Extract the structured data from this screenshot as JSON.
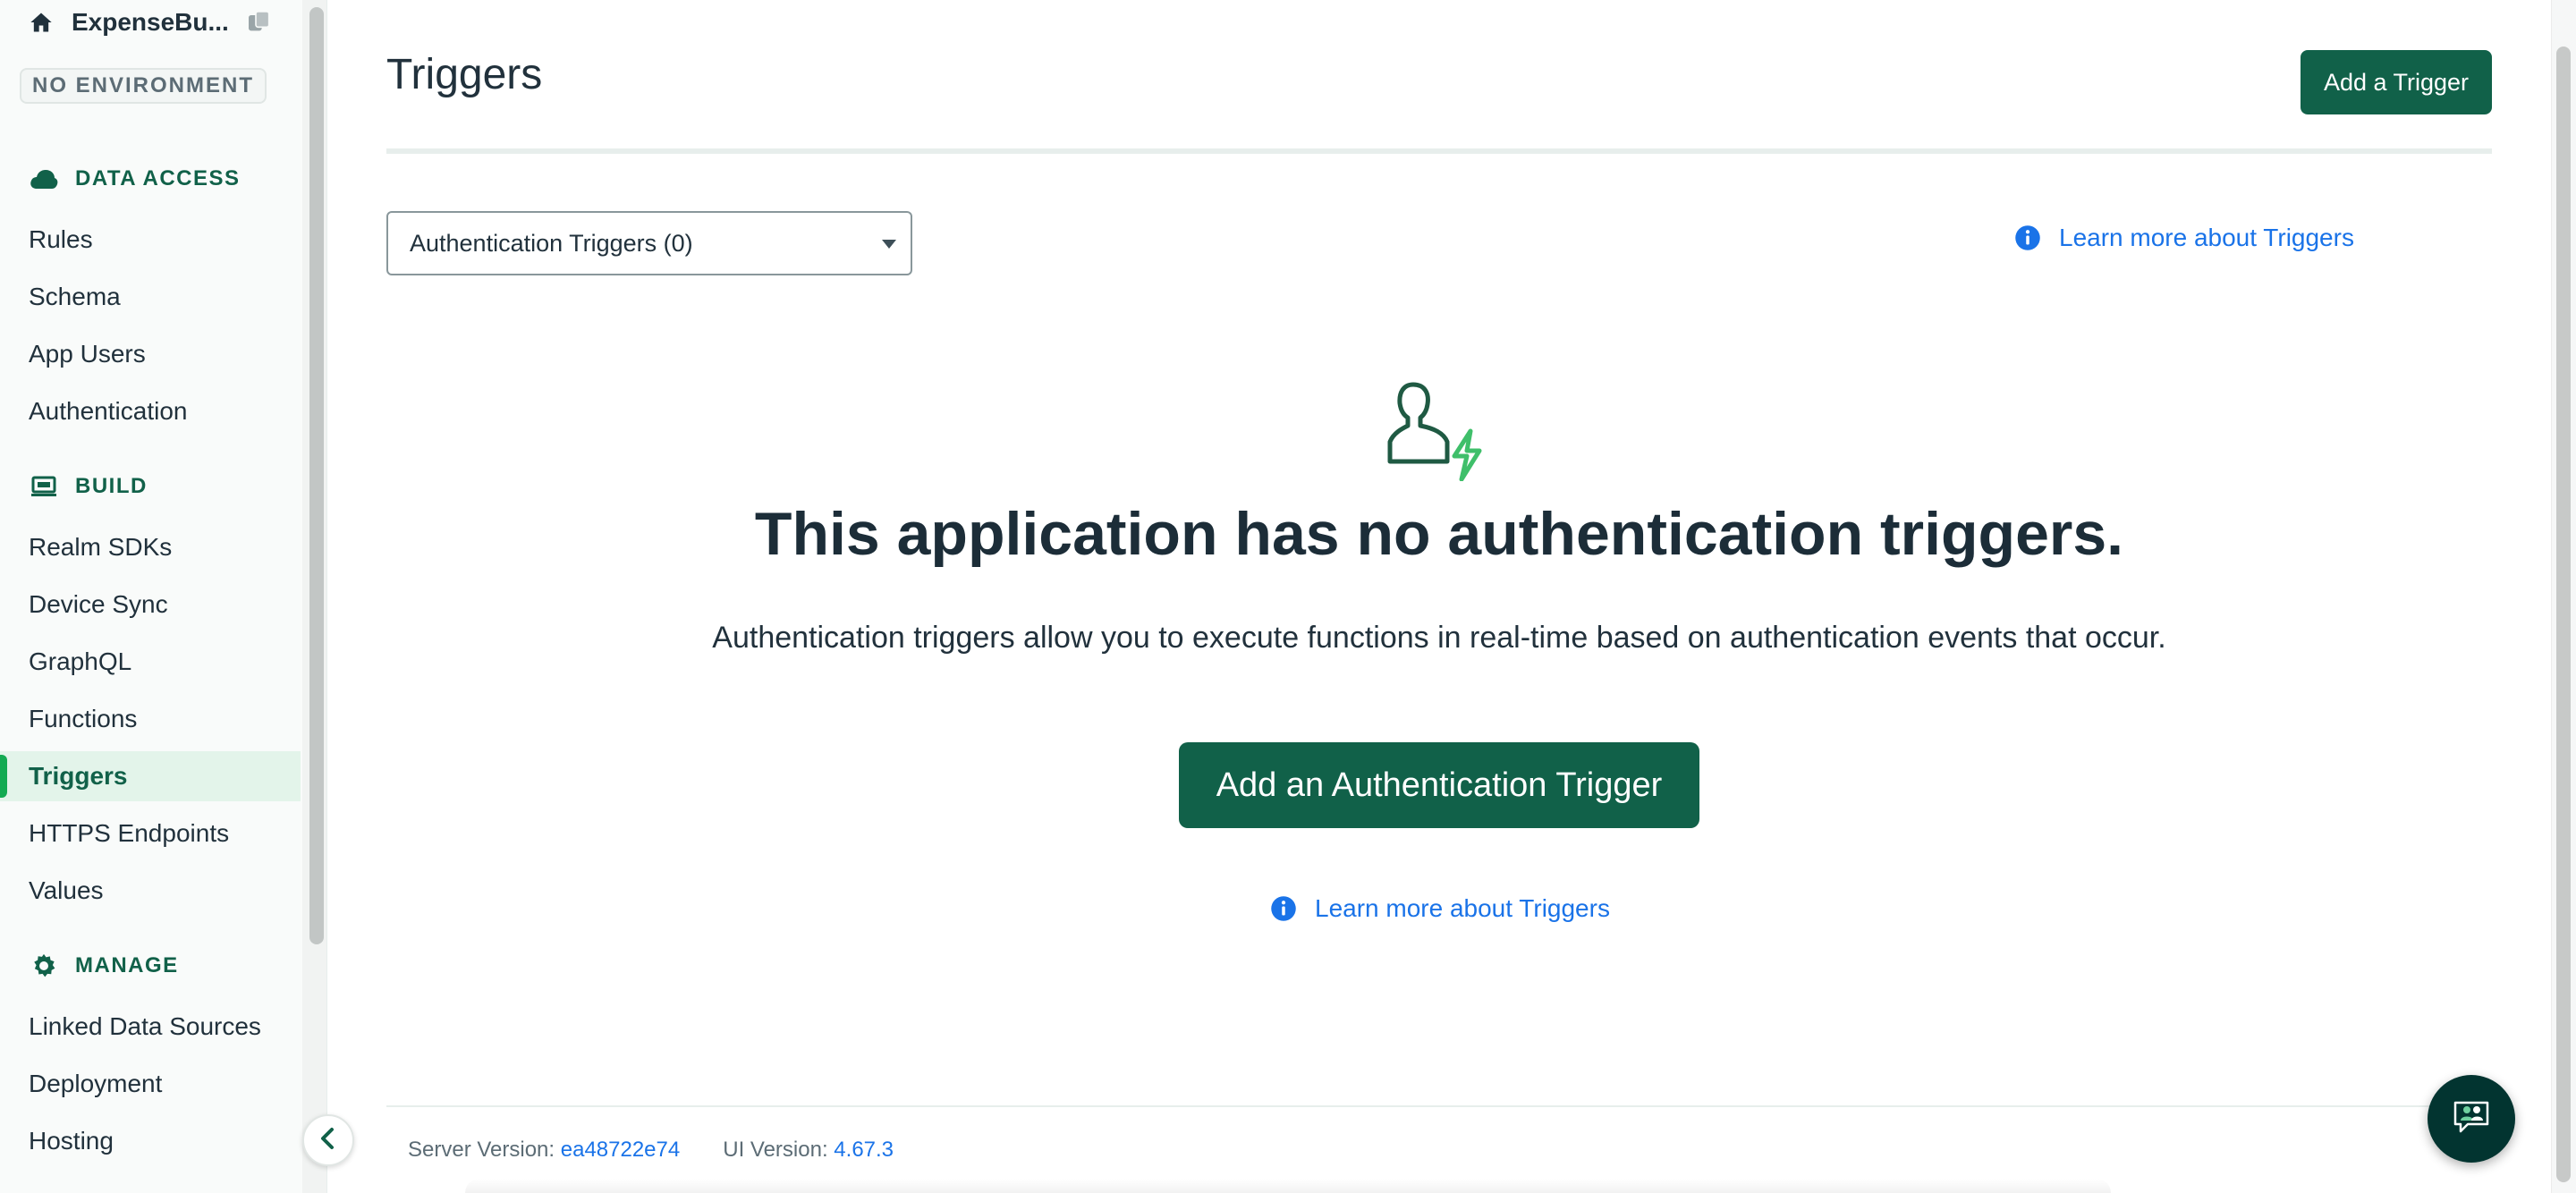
{
  "sidebar": {
    "app_name": "ExpenseBu...",
    "environment_badge": "NO ENVIRONMENT",
    "sections": {
      "data_access": {
        "title": "DATA ACCESS",
        "items": [
          "Rules",
          "Schema",
          "App Users",
          "Authentication"
        ]
      },
      "build": {
        "title": "BUILD",
        "items": [
          "Realm SDKs",
          "Device Sync",
          "GraphQL",
          "Functions",
          "Triggers",
          "HTTPS Endpoints",
          "Values"
        ]
      },
      "manage": {
        "title": "MANAGE",
        "items": [
          "Linked Data Sources",
          "Deployment",
          "Hosting"
        ]
      }
    },
    "active_item": "Triggers"
  },
  "header": {
    "title": "Triggers",
    "add_button": "Add a Trigger"
  },
  "filter": {
    "selected": "Authentication Triggers (0)"
  },
  "learn_more": "Learn more about Triggers",
  "empty_state": {
    "icon": "user-bolt-icon",
    "title": "This application has no authentication triggers.",
    "description": "Authentication triggers allow you to execute functions in real-time based on authentication events that occur.",
    "button": "Add an Authentication Trigger"
  },
  "footer": {
    "server_label": "Server Version:",
    "server_version": "ea48722e74",
    "ui_label": "UI Version:",
    "ui_version": "4.67.3"
  },
  "colors": {
    "primary": "#116149",
    "accent_green": "#13aa52",
    "link": "#1a73e8",
    "active_bg": "#e3f4ea"
  }
}
